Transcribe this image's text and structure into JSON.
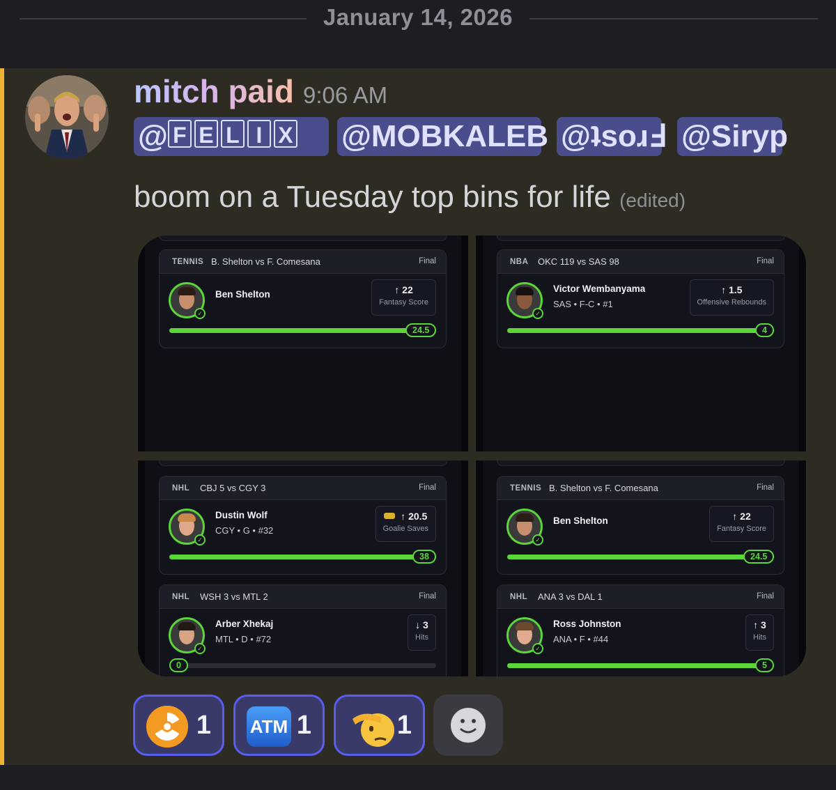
{
  "date_divider": {
    "date": "January 14, 2026"
  },
  "message": {
    "author": "mitch paid",
    "time": "9:06 AM",
    "mentions": [
      {
        "prefix": "@",
        "letters": [
          "F",
          "E",
          "L",
          "I",
          "X"
        ]
      },
      {
        "text": "@MOBKALEB"
      },
      {
        "text": "@ʇsoɹℲ"
      },
      {
        "text": "@Siryp"
      }
    ],
    "content": "boom on a Tuesday top bins for life",
    "edited_label": "(edited)"
  },
  "cards": [
    {
      "league": "TENNIS",
      "matchup": "B. Shelton vs F. Comesana",
      "status": "Final",
      "player": "Ben Shelton",
      "meta": "",
      "stat_value": "↑ 22",
      "stat_label": "Fantasy Score",
      "progress_value": "24.5",
      "progress_fraction": 1.0
    },
    {
      "league": "NBA",
      "matchup": "OKC 119 vs SAS 98",
      "status": "Final",
      "player": "Victor Wembanyama",
      "meta": "SAS • F-C • #1",
      "stat_value": "↑ 1.5",
      "stat_label": "Offensive Rebounds",
      "progress_value": "4",
      "progress_fraction": 1.0
    },
    {
      "league": "NHL",
      "matchup": "CBJ 5 vs CGY 3",
      "status": "Final",
      "player": "Dustin Wolf",
      "meta": "CGY • G • #32",
      "stat_value": "↑ 20.5",
      "stat_label": "Goalie Saves",
      "progress_value": "38",
      "progress_fraction": 1.0
    },
    {
      "league": "TENNIS",
      "matchup": "B. Shelton vs F. Comesana",
      "status": "Final",
      "player": "Ben Shelton",
      "meta": "",
      "stat_value": "↑ 22",
      "stat_label": "Fantasy Score",
      "progress_value": "24.5",
      "progress_fraction": 1.0
    },
    {
      "league": "NHL",
      "matchup": "WSH 3 vs MTL 2",
      "status": "Final",
      "player": "Arber Xhekaj",
      "meta": "MTL • D • #72",
      "stat_value": "↓ 3",
      "stat_label": "Hits",
      "progress_value": "0",
      "progress_fraction": 0.0
    },
    {
      "league": "NHL",
      "matchup": "ANA 3 vs DAL 1",
      "status": "Final",
      "player": "Ross Johnston",
      "meta": "ANA • F • #44",
      "stat_value": "↑ 3",
      "stat_label": "Hits",
      "progress_value": "5",
      "progress_fraction": 1.0
    }
  ],
  "reactions": [
    {
      "emoji": "radioactive-emoji",
      "count": "1"
    },
    {
      "emoji": "atm-sign-emoji",
      "atm_text": "ATM",
      "count": "1"
    },
    {
      "emoji": "saluting-face-emoji",
      "count": "1"
    }
  ],
  "colors": {
    "accent_bar": "#f0b232",
    "mention_bg": "#4a4d8c",
    "progress_green": "#5bd63a",
    "reaction_border": "#5a5ef0"
  }
}
